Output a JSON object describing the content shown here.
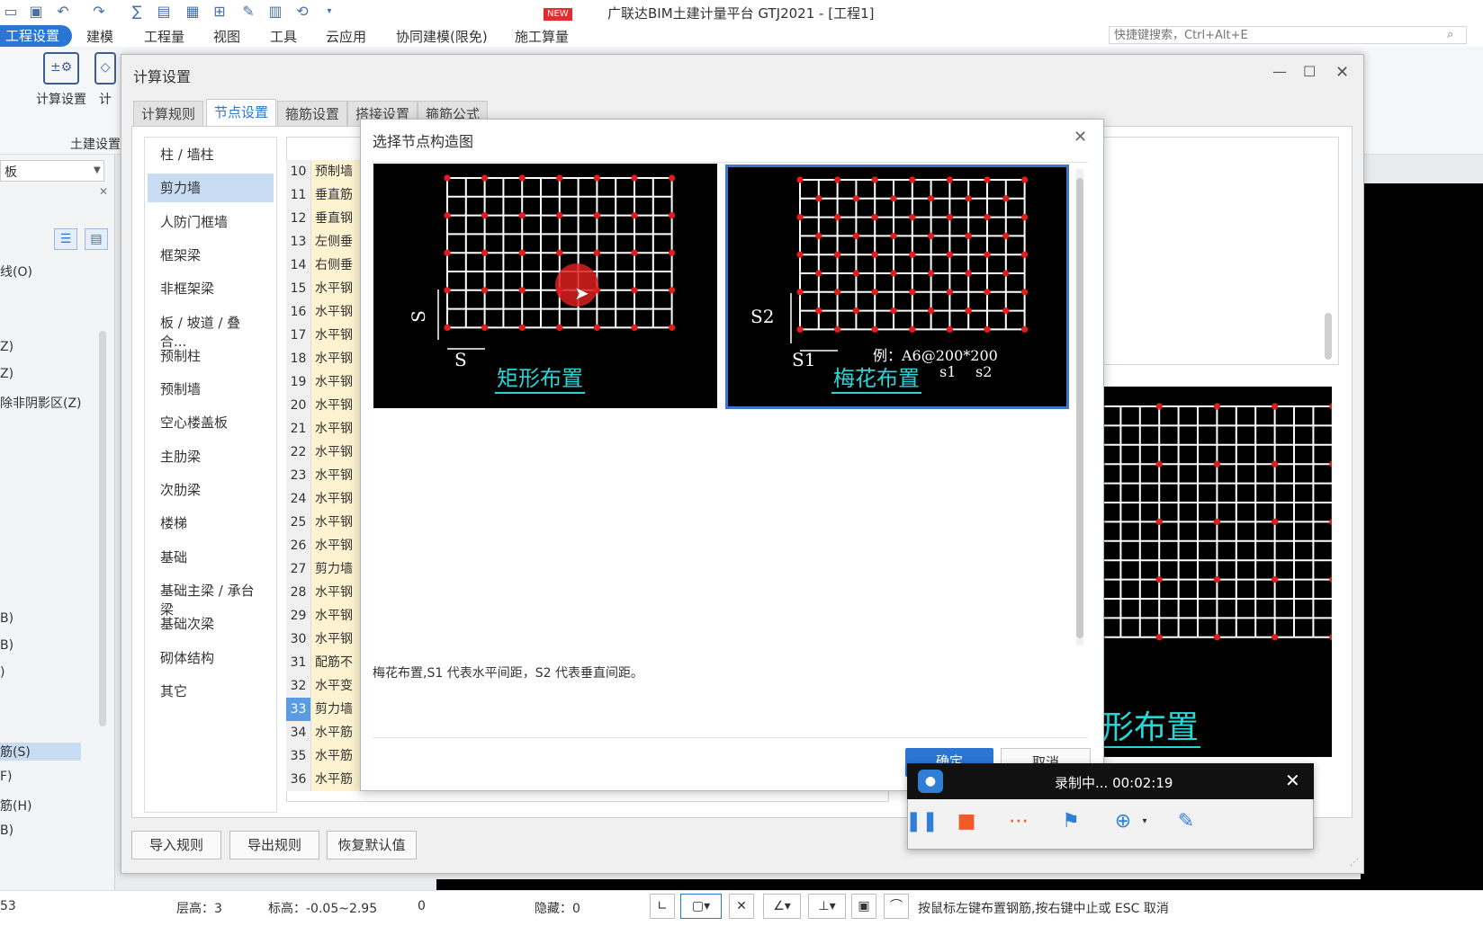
{
  "app": {
    "title": "广联达BIM土建计量平台 GTJ2021 - [工程1]",
    "new_badge": "NEW",
    "quick_search_placeholder": "快捷键搜索，Ctrl+Alt+E"
  },
  "menu": [
    "工程设置",
    "建模",
    "工程量",
    "视图",
    "工具",
    "云应用",
    "协同建模(限免)",
    "施工算量"
  ],
  "ribbon": {
    "buttons": [
      "计算设置",
      "计"
    ],
    "group_label": "土建设置"
  },
  "left_panel": {
    "combo_value": "板",
    "items": [
      "线(O)",
      "Z)",
      "Z)",
      "除非阴影区(Z)",
      "B)",
      "B)",
      ")",
      "筋(S)",
      "F)",
      "筋(H)",
      "B)"
    ]
  },
  "calc_dialog": {
    "title": "计算设置",
    "tabs": [
      "计算规则",
      "节点设置",
      "箍筋设置",
      "搭接设置",
      "箍筋公式"
    ],
    "categories": [
      "柱 / 墙柱",
      "剪力墙",
      "人防门框墙",
      "框架梁",
      "非框架梁",
      "板 / 坡道 / 叠合...",
      "预制柱",
      "预制墙",
      "空心楼盖板",
      "主肋梁",
      "次肋梁",
      "楼梯",
      "基础",
      "基础主梁 / 承台梁",
      "基础次梁",
      "砌体结构",
      "其它"
    ],
    "rules": [
      {
        "num": "10",
        "name": "预制墙"
      },
      {
        "num": "11",
        "name": "垂直筋"
      },
      {
        "num": "12",
        "name": "垂直钢"
      },
      {
        "num": "13",
        "name": "左侧垂"
      },
      {
        "num": "14",
        "name": "右侧垂"
      },
      {
        "num": "15",
        "name": "水平钢"
      },
      {
        "num": "16",
        "name": "水平钢"
      },
      {
        "num": "17",
        "name": "水平钢"
      },
      {
        "num": "18",
        "name": "水平钢"
      },
      {
        "num": "19",
        "name": "水平钢"
      },
      {
        "num": "20",
        "name": "水平钢"
      },
      {
        "num": "21",
        "name": "水平钢"
      },
      {
        "num": "22",
        "name": "水平钢"
      },
      {
        "num": "23",
        "name": "水平钢"
      },
      {
        "num": "24",
        "name": "水平钢"
      },
      {
        "num": "25",
        "name": "水平钢"
      },
      {
        "num": "26",
        "name": "水平钢"
      },
      {
        "num": "27",
        "name": "剪力墙"
      },
      {
        "num": "28",
        "name": "水平钢"
      },
      {
        "num": "29",
        "name": "水平钢"
      },
      {
        "num": "30",
        "name": "水平钢"
      },
      {
        "num": "31",
        "name": "配筋不"
      },
      {
        "num": "32",
        "name": "水平变"
      },
      {
        "num": "33",
        "name": "剪力墙"
      },
      {
        "num": "34",
        "name": "水平筋"
      },
      {
        "num": "35",
        "name": "水平筋"
      },
      {
        "num": "36",
        "name": "水平筋"
      }
    ],
    "footer_buttons": [
      "导入规则",
      "导出规则",
      "恢复默认值"
    ],
    "right_image_label": "形布置"
  },
  "node_popup": {
    "title": "选择节点构造图",
    "options": [
      {
        "label": "矩形布置",
        "dim": "S"
      },
      {
        "label": "梅花布置",
        "dim_h": "S1",
        "dim_v": "S2",
        "example": "例：A6@200*200",
        "s1": "s1",
        "s2": "s2"
      }
    ],
    "description": "梅花布置,S1 代表水平间距，S2 代表垂直间距。",
    "ok_label": "确定",
    "cancel_label": "取消"
  },
  "recorder": {
    "status": "录制中... 00:02:19"
  },
  "status_bar": {
    "item_53": "53",
    "floor": "层高：3",
    "elevation": "标高：-0.05~2.95",
    "zero": "0",
    "hidden": "隐藏：0",
    "hint": "按鼠标左键布置钢筋,按右键中止或 ESC 取消"
  },
  "colors": {
    "accent": "#2a76d2",
    "grid_line": "#ffffff",
    "node_dot": "#e41b1b",
    "label_cyan": "#29d6d6",
    "rule_name_bg": "#fdf3d0"
  }
}
